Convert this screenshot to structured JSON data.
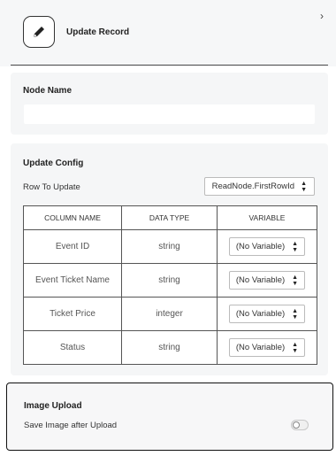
{
  "header": {
    "title": "Update Record",
    "icon": "pencil-icon",
    "collapse_icon": "chevron-right-icon"
  },
  "node_name": {
    "label": "Node Name",
    "value": ""
  },
  "update_config": {
    "label": "Update Config",
    "row_label": "Row To Update",
    "row_value": "ReadNode.FirstRowId",
    "columns": [
      "COLUMN NAME",
      "DATA TYPE",
      "VARIABLE"
    ],
    "rows": [
      {
        "name": "Event ID",
        "type": "string",
        "variable": "(No Variable)"
      },
      {
        "name": "Event Ticket Name",
        "type": "string",
        "variable": "(No Variable)"
      },
      {
        "name": "Ticket Price",
        "type": "integer",
        "variable": "(No Variable)"
      },
      {
        "name": "Status",
        "type": "string",
        "variable": "(No Variable)"
      }
    ]
  },
  "image_upload": {
    "label": "Image Upload",
    "option_label": "Save Image after Upload",
    "enabled": false
  },
  "colors": {
    "panel_bg": "#f5f6f7",
    "border_dark": "#111111",
    "text": "#222222"
  }
}
